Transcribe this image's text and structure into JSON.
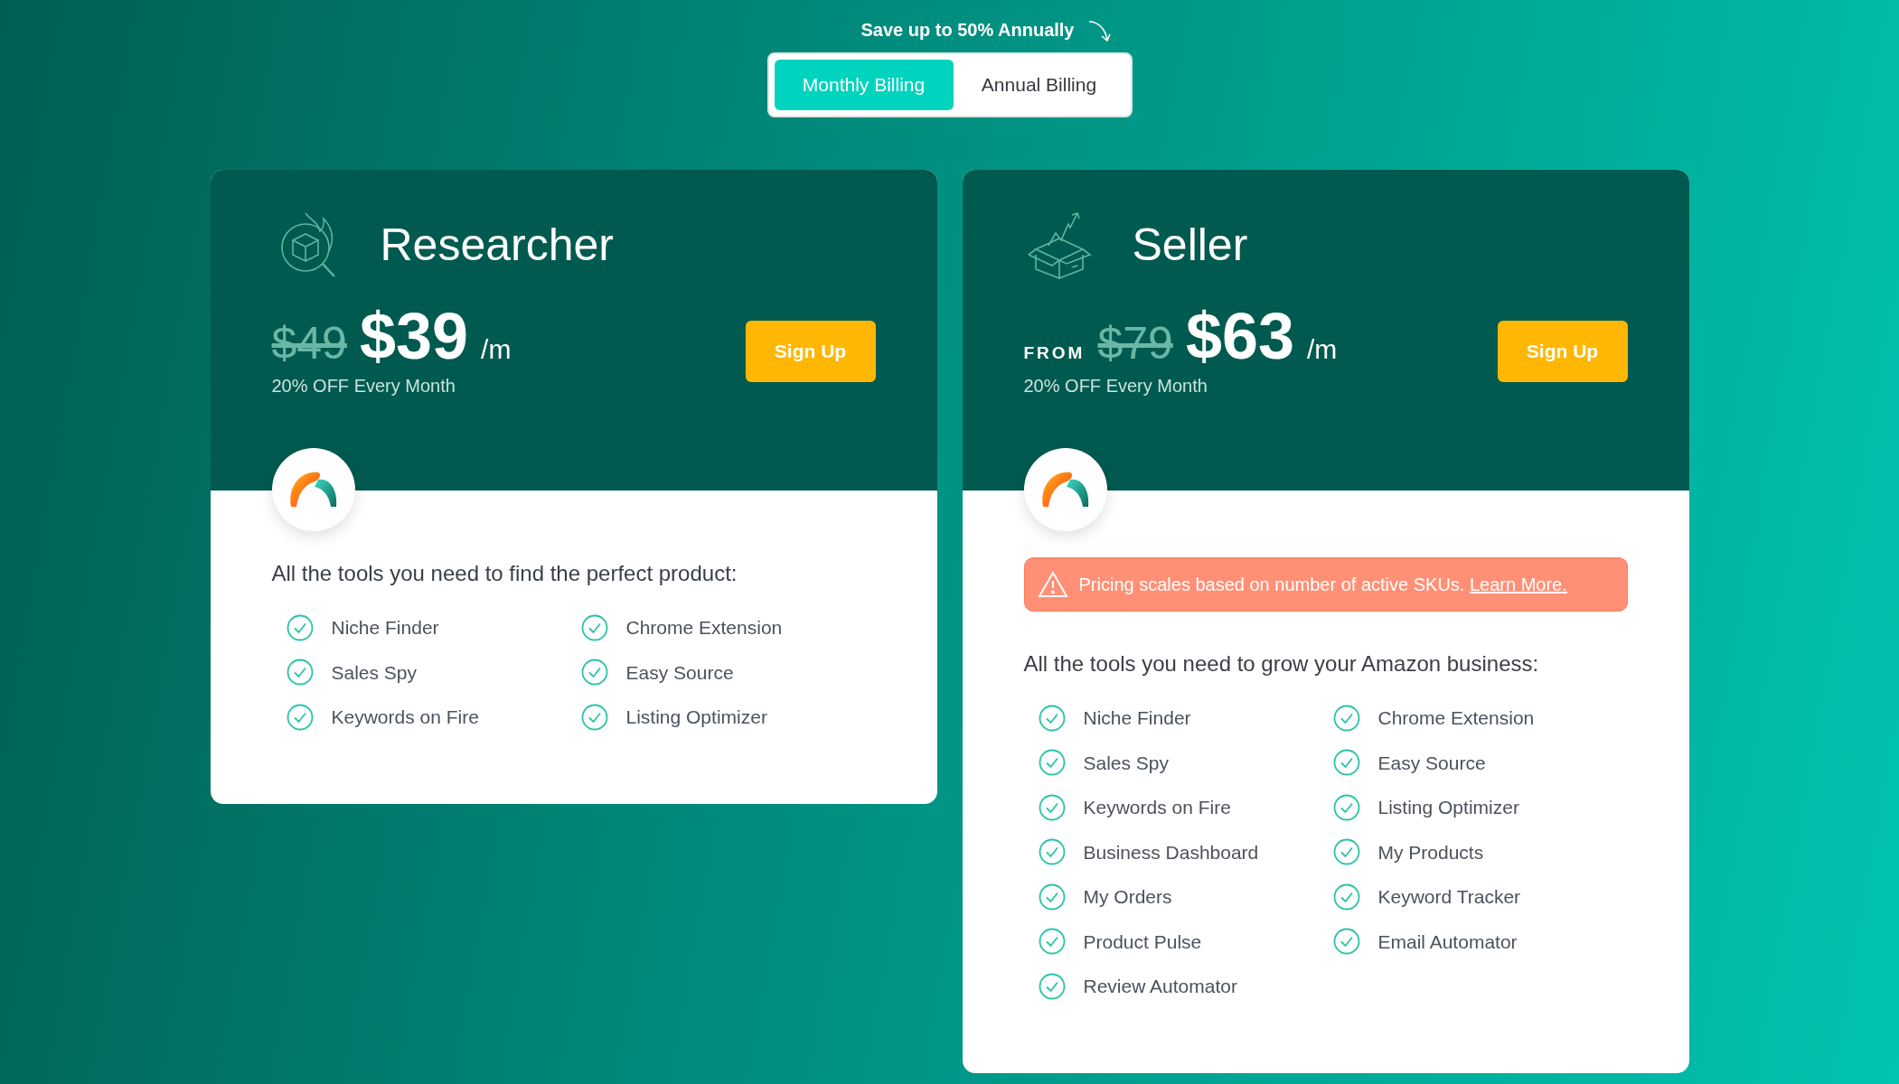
{
  "promo": "Save up to 50% Annually",
  "billing_tabs": [
    {
      "label": "Monthly Billing",
      "selected": true
    },
    {
      "label": "Annual Billing",
      "selected": false
    }
  ],
  "plans": [
    {
      "name": "Researcher",
      "old_price": "$49",
      "price": "$39",
      "per": "/m",
      "discount": "20% OFF Every Month",
      "button": "Sign Up",
      "description": "All the tools you need to find the perfect product:",
      "features": [
        "Niche Finder",
        "Chrome Extension",
        "Sales Spy",
        "Easy Source",
        "Keywords on Fire",
        "Listing Optimizer"
      ]
    },
    {
      "name": "Seller",
      "from_label": "FROM",
      "old_price": "$79",
      "price": "$63",
      "per": "/m",
      "discount": "20% OFF Every Month",
      "button": "Sign Up",
      "notice": {
        "text": "Pricing scales based on number of active SKUs.",
        "link": "Learn More."
      },
      "description": "All the tools you need to grow your Amazon business:",
      "features": [
        "Niche Finder",
        "Chrome Extension",
        "Sales Spy",
        "Easy Source",
        "Keywords on Fire",
        "Listing Optimizer",
        "Business Dashboard",
        "My Products",
        "My Orders",
        "Keyword Tracker",
        "Product Pulse",
        "Email Automator",
        "Review Automator"
      ]
    }
  ]
}
